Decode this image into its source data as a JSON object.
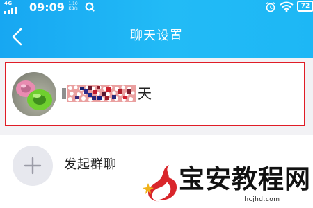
{
  "status_bar": {
    "network": "4G",
    "time": "09:09",
    "speed_value": "1.10",
    "speed_unit": "KB/s",
    "battery": "72"
  },
  "nav": {
    "title": "聊天设置"
  },
  "contact": {
    "name_visible_part": "天"
  },
  "actions": {
    "start_group_chat": "发起群聊"
  },
  "watermark": {
    "title": "宝安教程网",
    "url": "hcjhd.com"
  },
  "colors": {
    "header_blue": "#1db7f5",
    "highlight_red": "#e01d27",
    "plus_circle_bg": "#e7e8ee",
    "watermark_red": "#d9262b"
  },
  "icons": {
    "back": "chevron-left-icon",
    "alarm": "alarm-clock-icon",
    "wifi": "wifi-icon",
    "add": "plus-icon",
    "notification": "qq-icon"
  }
}
